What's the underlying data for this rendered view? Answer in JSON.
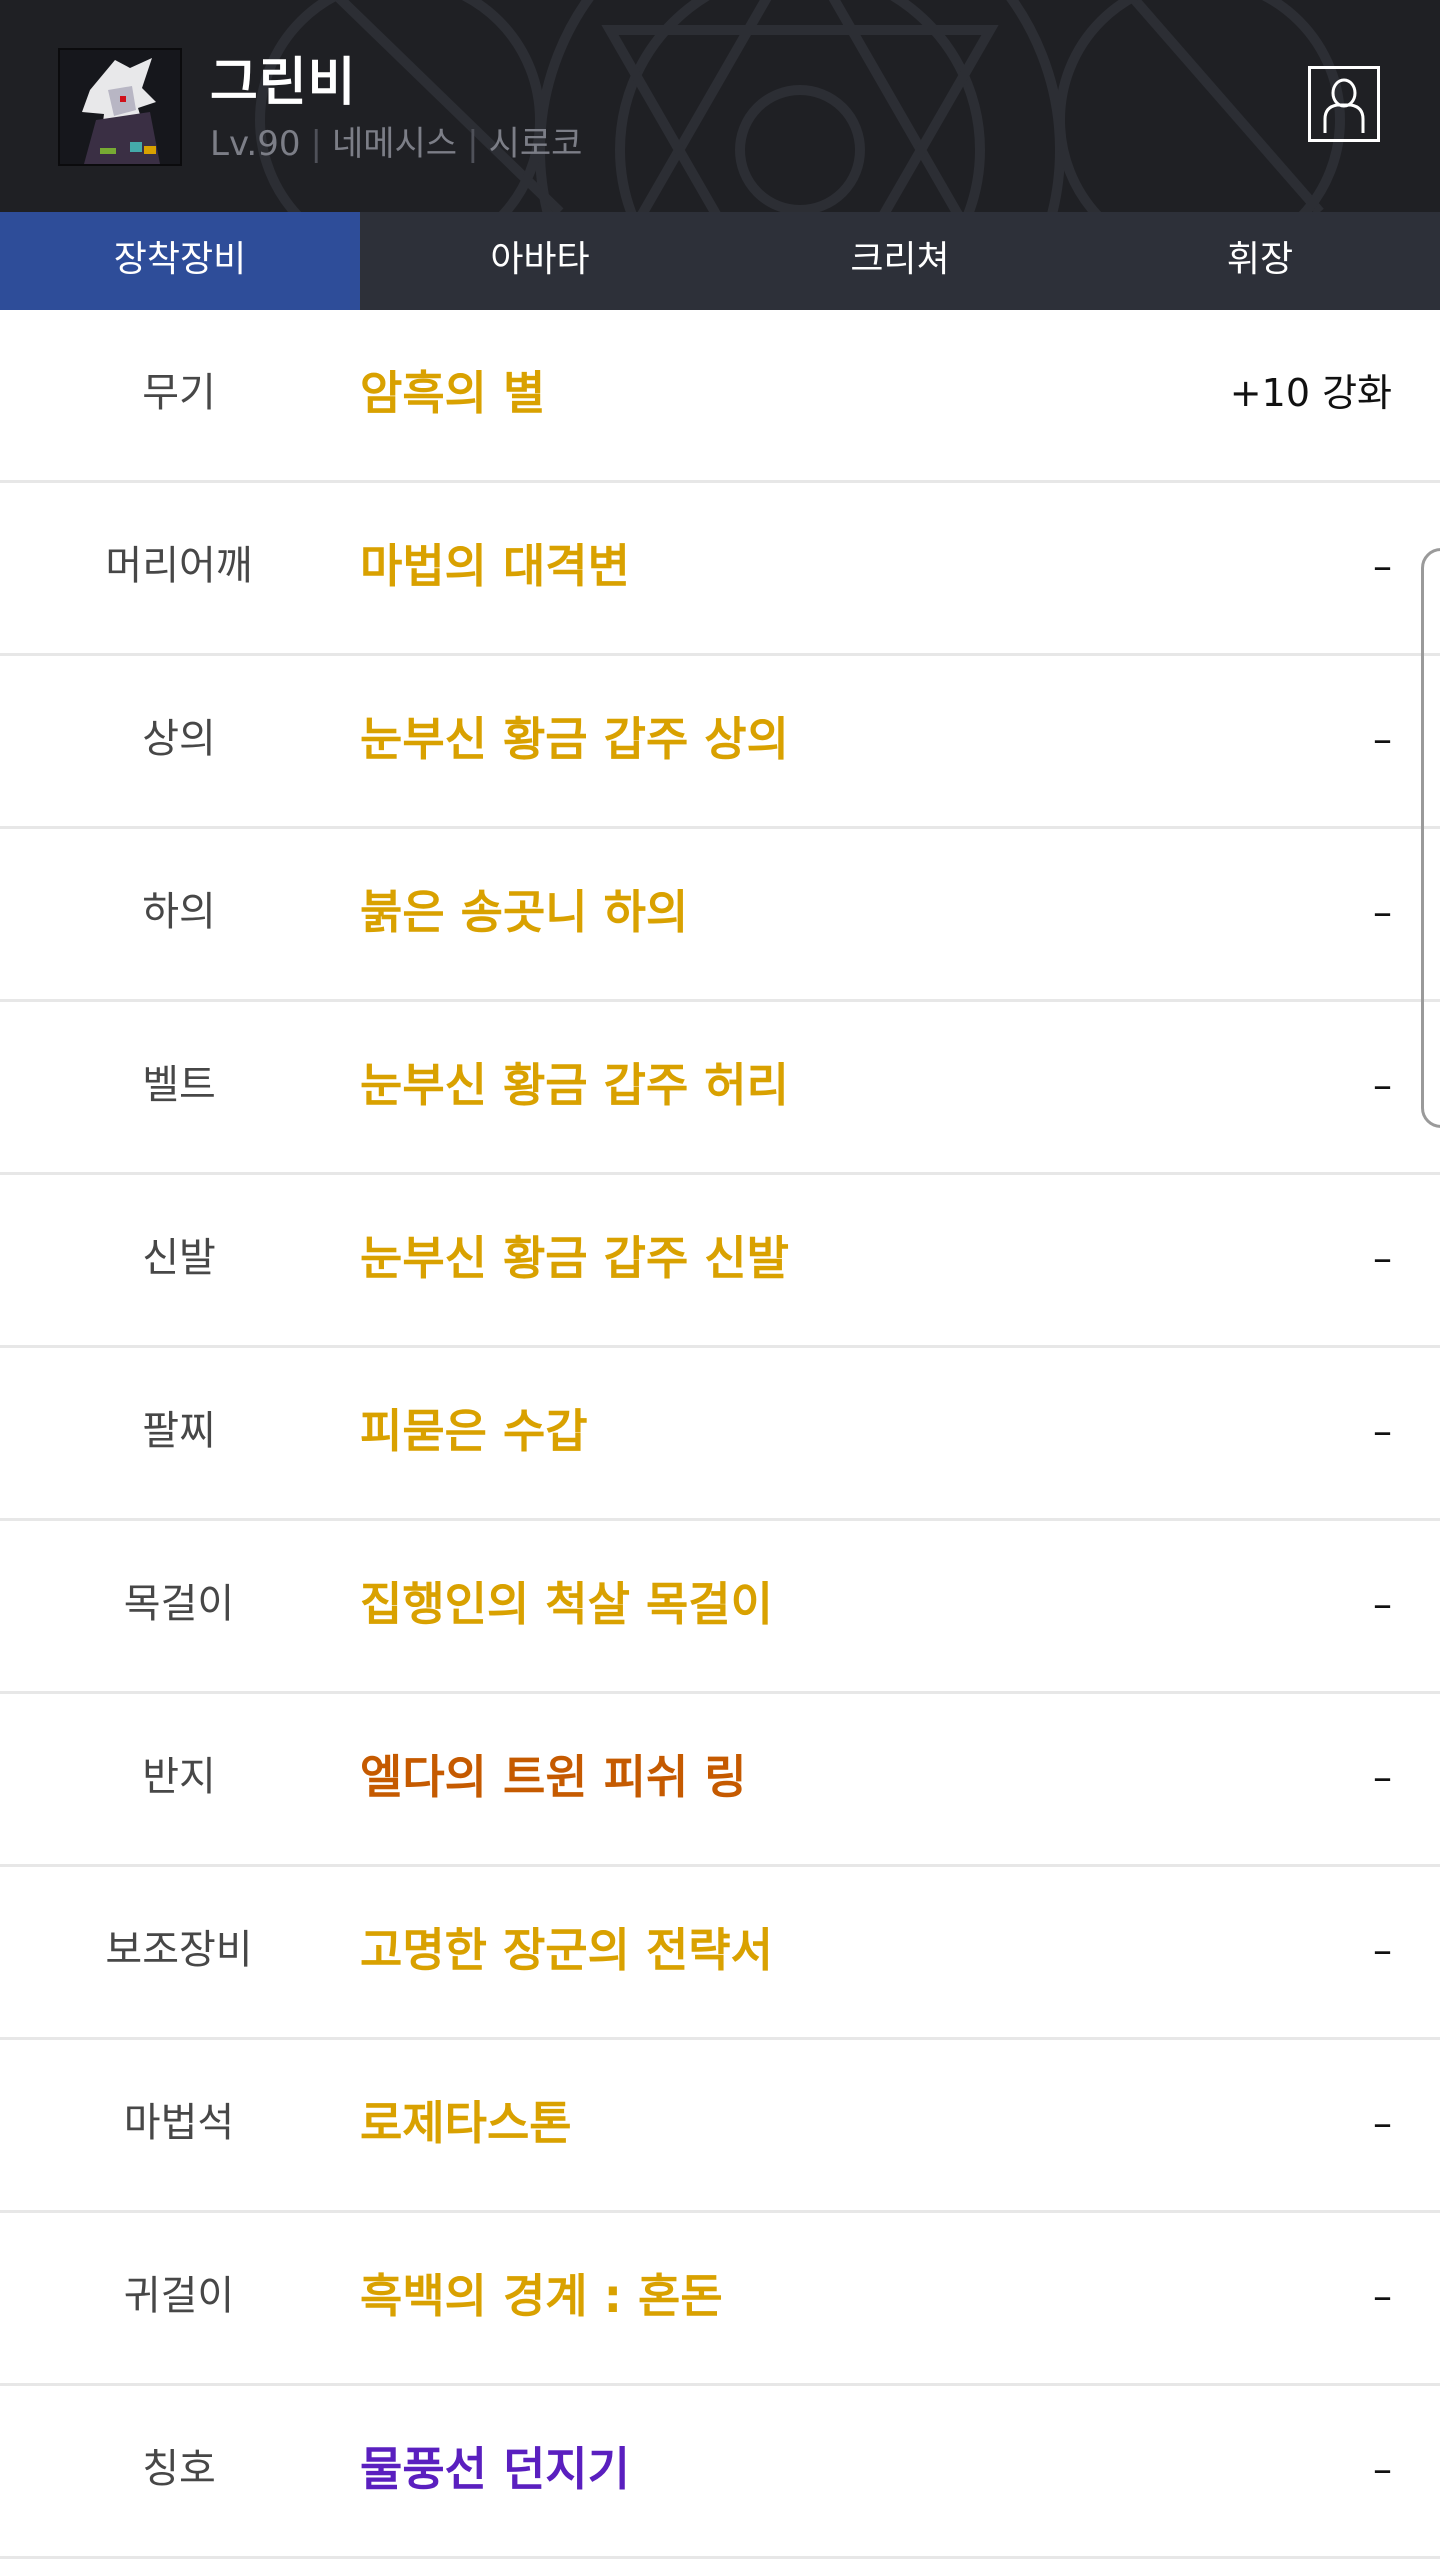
{
  "header": {
    "character_name": "그린비",
    "level": "Lv.90",
    "job": "네메시스",
    "server": "시로코",
    "separator": "|"
  },
  "tabs": [
    {
      "label": "장착장비",
      "active": true
    },
    {
      "label": "아바타",
      "active": false
    },
    {
      "label": "크리쳐",
      "active": false
    },
    {
      "label": "휘장",
      "active": false
    }
  ],
  "equipment": [
    {
      "slot": "무기",
      "item": "암흑의 별",
      "enhance": "+10 강화",
      "color": "#d9a100"
    },
    {
      "slot": "머리어깨",
      "item": "마법의 대격변",
      "enhance": "–",
      "color": "#d9a100"
    },
    {
      "slot": "상의",
      "item": "눈부신 황금 갑주 상의",
      "enhance": "–",
      "color": "#d9a100"
    },
    {
      "slot": "하의",
      "item": "붉은 송곳니 하의",
      "enhance": "–",
      "color": "#d9a100"
    },
    {
      "slot": "벨트",
      "item": "눈부신 황금 갑주 허리",
      "enhance": "–",
      "color": "#d9a100"
    },
    {
      "slot": "신발",
      "item": "눈부신 황금 갑주 신발",
      "enhance": "–",
      "color": "#d9a100"
    },
    {
      "slot": "팔찌",
      "item": "피묻은 수갑",
      "enhance": "–",
      "color": "#d9a100"
    },
    {
      "slot": "목걸이",
      "item": "집행인의 척살 목걸이",
      "enhance": "–",
      "color": "#d9a100"
    },
    {
      "slot": "반지",
      "item": "엘다의 트윈 피쉬 링",
      "enhance": "–",
      "color": "#c55a00"
    },
    {
      "slot": "보조장비",
      "item": "고명한 장군의 전략서",
      "enhance": "–",
      "color": "#d9a100"
    },
    {
      "slot": "마법석",
      "item": "로제타스톤",
      "enhance": "–",
      "color": "#d9a100"
    },
    {
      "slot": "귀걸이",
      "item": "흑백의 경계 : 혼돈",
      "enhance": "–",
      "color": "#d9a100"
    },
    {
      "slot": "칭호",
      "item": "물풍선 던지기",
      "enhance": "–",
      "color": "#5a1fbf"
    }
  ],
  "icons": {
    "avatar": "character-portrait",
    "profile": "user-profile-icon"
  },
  "colors": {
    "header_bg": "#1f2024",
    "tab_bar": "#2d3039",
    "tab_active": "#2e4d99",
    "epic": "#d9a100",
    "legendary": "#c55a00",
    "title": "#5a1fbf"
  }
}
